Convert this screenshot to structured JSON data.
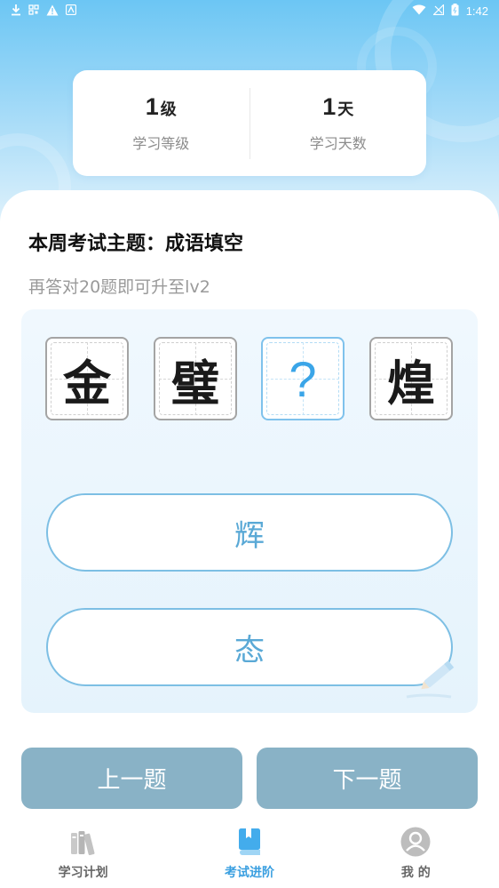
{
  "status_bar": {
    "time": "1:42",
    "left_icons": [
      "download-icon",
      "qr-icon",
      "warning-icon",
      "app-icon"
    ],
    "right_icons": [
      "wifi-icon",
      "signal-icon",
      "battery-icon"
    ]
  },
  "stats": {
    "level": {
      "value": "1",
      "unit": "级",
      "label": "学习等级"
    },
    "days": {
      "value": "1",
      "unit": "天",
      "label": "学习天数"
    }
  },
  "exam": {
    "title": "本周考试主题：成语填空",
    "subtitle": "再答对20题即可升至lv2",
    "idiom_chars": [
      "金",
      "璧",
      "?",
      "煌"
    ],
    "blank_index": 2,
    "options": [
      "辉",
      "态"
    ]
  },
  "buttons": {
    "prev": "上一题",
    "next": "下一题"
  },
  "tabs": [
    {
      "label": "学习计划",
      "icon": "books-icon",
      "active": false
    },
    {
      "label": "考试进阶",
      "icon": "book-icon",
      "active": true
    },
    {
      "label": "我 的",
      "icon": "user-icon",
      "active": false
    }
  ],
  "colors": {
    "accent": "#3a9fe0",
    "option_border": "#7dbfe4",
    "nav_button": "#89b2c6"
  }
}
